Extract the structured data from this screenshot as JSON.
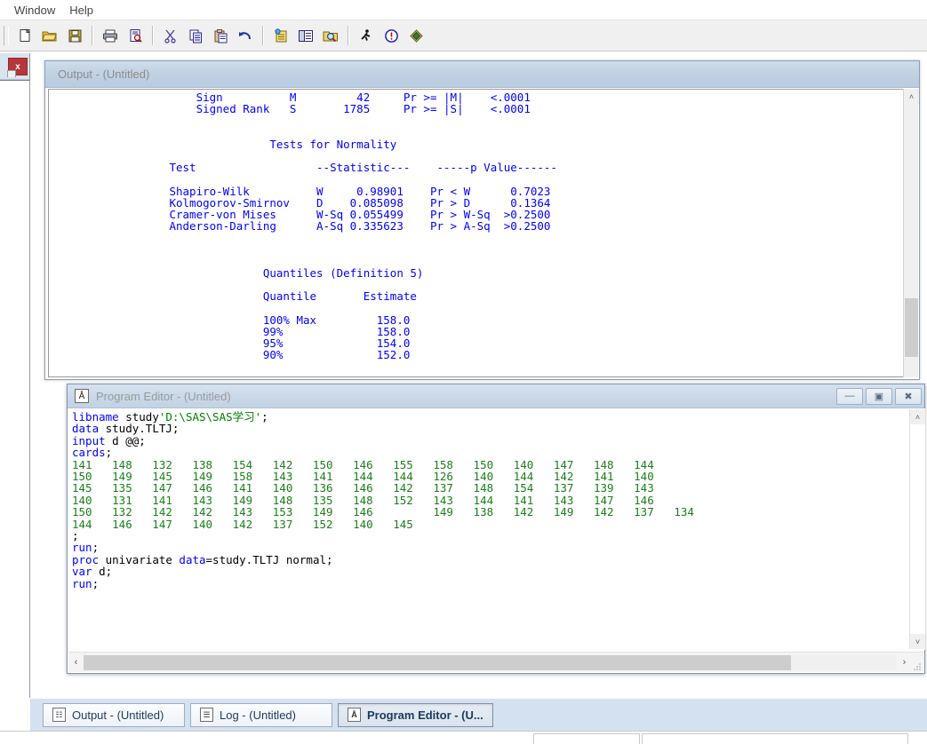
{
  "menubar": {
    "items": [
      {
        "label": "Window",
        "name": "menu-window"
      },
      {
        "label": "Help",
        "name": "menu-help"
      }
    ]
  },
  "toolbar": {
    "buttons": [
      {
        "name": "new-icon",
        "glyph": "🗋",
        "title": "New"
      },
      {
        "name": "open-folder-icon",
        "glyph": "📂",
        "title": "Open"
      },
      {
        "name": "save-icon",
        "glyph": "💾",
        "title": "Save"
      },
      {
        "name": "print-icon",
        "glyph": "🖨",
        "title": "Print"
      },
      {
        "name": "print-preview-icon",
        "glyph": "🔍",
        "title": "Print Preview"
      },
      {
        "name": "cut-scissors-icon",
        "glyph": "✂",
        "title": "Cut"
      },
      {
        "name": "copy-icon",
        "glyph": "📋",
        "title": "Copy"
      },
      {
        "name": "paste-icon",
        "glyph": "📄",
        "title": "Paste"
      },
      {
        "name": "undo-arrow-icon",
        "glyph": "↶",
        "title": "Undo"
      },
      {
        "name": "new-library-icon",
        "glyph": "🗒",
        "title": "New Library"
      },
      {
        "name": "explorer-icon",
        "glyph": "🖽",
        "title": "Explorer"
      },
      {
        "name": "find-folder-icon",
        "glyph": "🔎",
        "title": "Search"
      },
      {
        "name": "submit-runner-icon",
        "glyph": "🏃",
        "title": "Submit"
      },
      {
        "name": "clear-all-icon",
        "glyph": "❗",
        "title": "Clear All"
      },
      {
        "name": "help-icon",
        "glyph": "◈",
        "title": "Help"
      }
    ]
  },
  "left_stub": {
    "close_label": "x"
  },
  "output_window": {
    "title": "Output - (Untitled)",
    "text": "                      Sign          M         42     Pr >= |M|    <.0001\n                      Signed Rank   S       1785     Pr >= |S|    <.0001\n\n\n                                 Tests for Normality\n\n                  Test                  --Statistic---    -----p Value------\n\n                  Shapiro-Wilk          W     0.98901    Pr < W      0.7023\n                  Kolmogorov-Smirnov    D    0.085098    Pr > D      0.1364\n                  Cramer-von Mises      W-Sq 0.055499    Pr > W-Sq  >0.2500\n                  Anderson-Darling      A-Sq 0.335623    Pr > A-Sq  >0.2500\n\n\n\n                                Quantiles (Definition 5)\n\n                                Quantile       Estimate\n\n                                100% Max         158.0\n                                99%              158.0\n                                95%              154.0\n                                90%              152.0"
  },
  "editor_window": {
    "title": "Program Editor - (Untitled)",
    "icon_glyph": "Å",
    "window_buttons": [
      {
        "name": "minimize-button",
        "glyph": "—"
      },
      {
        "name": "restore-button",
        "glyph": "▣"
      },
      {
        "name": "close-button",
        "glyph": "✖"
      }
    ],
    "code_lines": [
      [
        {
          "t": "libname",
          "c": "kw"
        },
        {
          "t": " study",
          "c": "txt"
        },
        {
          "t": "'D:\\SAS\\SAS学习'",
          "c": "str"
        },
        {
          "t": ";",
          "c": "txt"
        }
      ],
      [
        {
          "t": "data",
          "c": "kw"
        },
        {
          "t": " study.TLTJ;",
          "c": "txt"
        }
      ],
      [
        {
          "t": "input",
          "c": "kw"
        },
        {
          "t": " d @@;",
          "c": "txt"
        }
      ],
      [
        {
          "t": "cards",
          "c": "kw"
        },
        {
          "t": ";",
          "c": "txt"
        }
      ],
      [
        {
          "t": "141   148   132   138   154   142   150   146   155   158   150   140   147   148   144",
          "c": "num"
        }
      ],
      [
        {
          "t": "150   149   145   149   158   143   141   144   144   126   140   144   142   141   140",
          "c": "num"
        }
      ],
      [
        {
          "t": "145   135   147   146   141   140   136   146   142   137   148   154   137   139   143",
          "c": "num"
        }
      ],
      [
        {
          "t": "140   131   141   143   149   148   135   148   152   143   144   141   143   147   146",
          "c": "num"
        }
      ],
      [
        {
          "t": "150   132   142   142   143   153   149   146         149   138   142   149   142   137   134",
          "c": "num"
        }
      ],
      [
        {
          "t": "144   146   147   140   142   137   152   140   145",
          "c": "num"
        }
      ],
      [
        {
          "t": ";",
          "c": "txt"
        }
      ],
      [
        {
          "t": "run",
          "c": "kw"
        },
        {
          "t": ";",
          "c": "txt"
        }
      ],
      [
        {
          "t": "proc",
          "c": "kw"
        },
        {
          "t": " univariate ",
          "c": "txt"
        },
        {
          "t": "data",
          "c": "kw"
        },
        {
          "t": "=study.TLTJ normal;",
          "c": "txt"
        }
      ],
      [
        {
          "t": "var",
          "c": "kw"
        },
        {
          "t": " d;",
          "c": "txt"
        }
      ],
      [
        {
          "t": "run",
          "c": "kw"
        },
        {
          "t": ";",
          "c": "txt"
        }
      ]
    ]
  },
  "taskbar": {
    "tabs": [
      {
        "label": "Output - (Untitled)",
        "name": "taskbar-tab-output",
        "icon": "output-icon",
        "icon_glyph": "☷",
        "active": false
      },
      {
        "label": "Log - (Untitled)",
        "name": "taskbar-tab-log",
        "icon": "log-icon",
        "icon_glyph": "☰",
        "active": false
      },
      {
        "label": "Program Editor - (U...",
        "name": "taskbar-tab-program-editor",
        "icon": "program-editor-icon",
        "icon_glyph": "Å",
        "active": true
      }
    ]
  },
  "scrollbars": {
    "up_arrow": "˄",
    "down_arrow": "˅",
    "left_arrow": "‹",
    "right_arrow": "›",
    "grip": "∷"
  }
}
